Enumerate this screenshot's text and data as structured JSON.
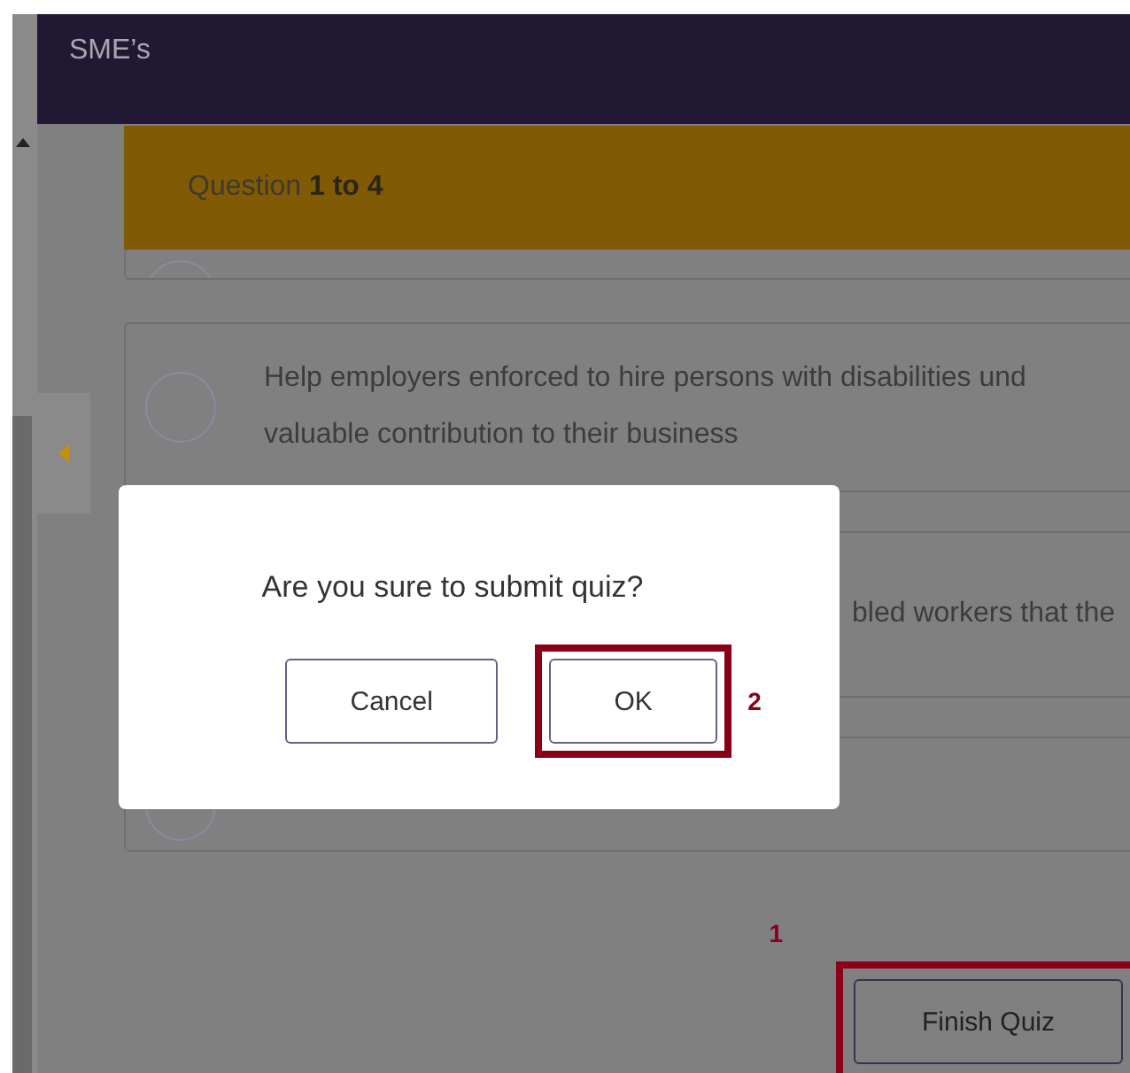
{
  "header": {
    "title": "SME’s"
  },
  "banner": {
    "text": "Question **1 to 4**"
  },
  "options": [
    {
      "selected": false
    },
    {
      "selected": false,
      "lines": [
        "Help employers enforced to hire persons with disabilities und",
        "valuable contribution to their business"
      ]
    },
    {
      "lines": [
        "bled workers that the"
      ]
    },
    {
      "selected": false
    }
  ],
  "dialog": {
    "message": "Are you sure to submit quiz?",
    "buttons": [
      {
        "label": "Cancel",
        "highlighted": false
      },
      {
        "label": "OK",
        "highlighted": true,
        "callout": "2"
      }
    ]
  },
  "finish_button": {
    "label": "Finish Quiz",
    "highlighted": true,
    "callout": "1"
  }
}
